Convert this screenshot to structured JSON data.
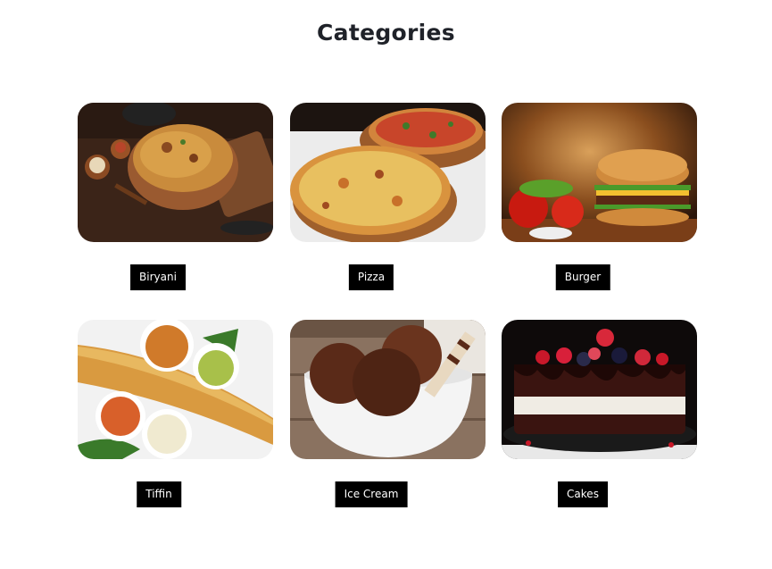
{
  "section": {
    "title": "Categories"
  },
  "categories": [
    {
      "name": "Biryani",
      "image": "biryani-image"
    },
    {
      "name": "Pizza",
      "image": "pizza-image"
    },
    {
      "name": "Burger",
      "image": "burger-image"
    },
    {
      "name": "Tiffin",
      "image": "tiffin-image"
    },
    {
      "name": "Ice Cream",
      "image": "ice-cream-image"
    },
    {
      "name": "Cakes",
      "image": "cakes-image"
    }
  ]
}
